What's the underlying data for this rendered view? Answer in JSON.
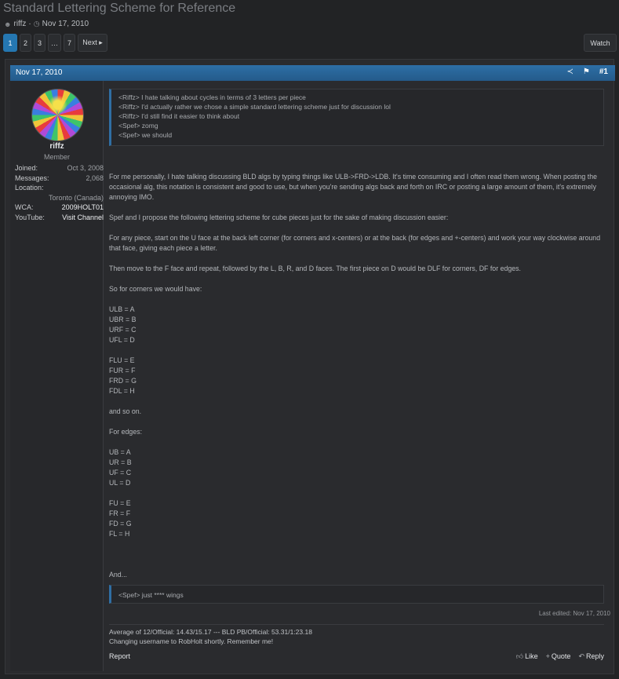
{
  "thread": {
    "title": "Standard Lettering Scheme for Reference",
    "author": "riffz",
    "separator": "·",
    "date": "Nov 17, 2010"
  },
  "pagination": {
    "pages": [
      "1",
      "2",
      "3",
      "…",
      "7"
    ],
    "next_label": "Next ▸",
    "current": "1"
  },
  "watch_label": "Watch",
  "post": {
    "date": "Nov 17, 2010",
    "number": "#1",
    "user": {
      "name": "riffz",
      "role": "Member",
      "joined_label": "Joined:",
      "joined": "Oct 3, 2008",
      "messages_label": "Messages:",
      "messages": "2,068",
      "location_label": "Location:",
      "location": "Toronto (Canada)",
      "wca_label": "WCA:",
      "wca": "2009HOLT01",
      "youtube_label": "YouTube:",
      "youtube": "Visit Channel"
    },
    "quote1": [
      "<Riffz> I hate talking about cycles in terms of 3 letters per piece",
      "<Riffz> I'd actually rather we chose a simple standard lettering scheme just for discussion lol",
      "<Riffz> I'd still find it easier to think about",
      "<Spef> zomg",
      "<Spef> we should"
    ],
    "paragraphs": [
      "For me personally, I hate talking discussing BLD algs by typing things like ULB->FRD->LDB. It's time consuming and I often read them wrong. When posting the occasional alg, this notation is consistent and good to use, but when you're sending algs back and forth on IRC or posting a large amount of them, it's extremely annoying IMO.",
      "Spef and I propose the following lettering scheme for cube pieces just for the sake of making discussion easier:",
      "For any piece, start on the U face at the back left corner (for corners and x-centers) or at the back (for edges and +-centers) and work your way clockwise around that face, giving each piece a letter.",
      "Then move to the F face and repeat, followed by the L, B, R, and D faces. The first piece on D would be DLF for corners, DF for edges.",
      "So for corners we would have:",
      "ULB = A\nUBR = B\nURF = C\nUFL = D",
      "FLU = E\nFUR = F\nFRD = G\nFDL = H",
      "and so on.",
      "For edges:",
      "UB = A\nUR = B\nUF = C\nUL = D",
      "FU = E\nFR = F\nFD = G\nFL = H",
      "",
      "And..."
    ],
    "quote2": "<Spef> just **** wings",
    "last_edited": "Last edited: Nov 17, 2010",
    "signature": [
      "Average of 12/Official: 14.43/15.17 --- BLD PB/Official: 53.31/1:23.18",
      "Changing username to RobHolt shortly. Remember me!"
    ],
    "actions": {
      "report": "Report",
      "like": "Like",
      "quote": "Quote",
      "reply": "Reply"
    }
  },
  "colors": {
    "accent": "#2577b1",
    "header_bar": "#2d6fa6",
    "background": "#222325"
  },
  "icons": [
    "user-icon",
    "clock-icon",
    "share-icon",
    "bookmark-icon",
    "thumbs-up-icon",
    "plus-icon",
    "reply-icon"
  ]
}
